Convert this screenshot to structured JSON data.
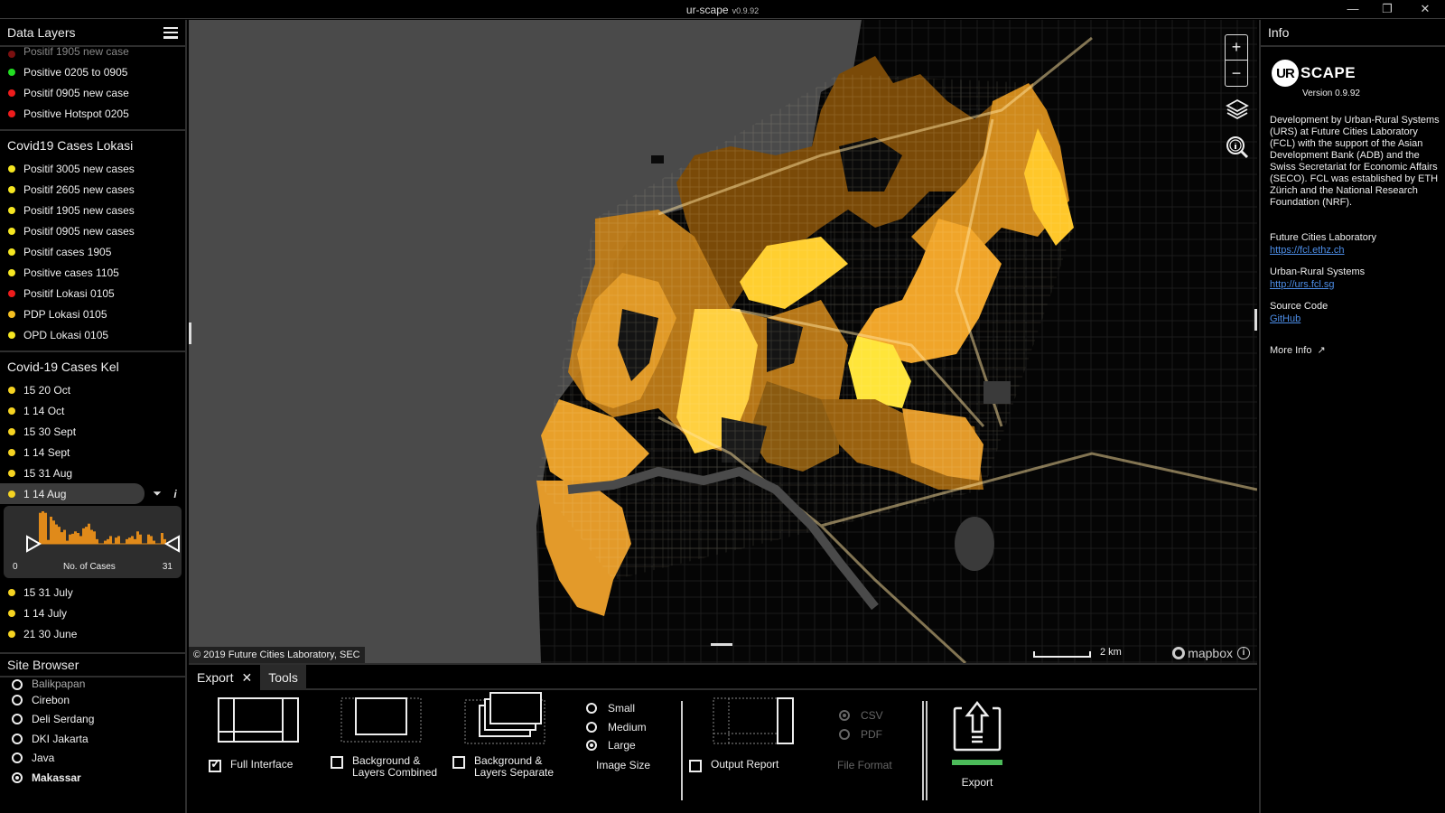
{
  "window": {
    "title": "ur-scape",
    "version": "v0.9.92",
    "controls": {
      "minimize": "—",
      "restore": "❐",
      "close": "✕"
    }
  },
  "data_layers": {
    "title": "Data Layers",
    "cut_item": "Positif 1905 new case",
    "top_items": [
      {
        "label": "Positive 0205 to 0905",
        "color": "#22dd22"
      },
      {
        "label": "Positif 0905 new case",
        "color": "#ee1c1c"
      },
      {
        "label": "Positive Hotspot 0205",
        "color": "#ee1c1c"
      }
    ],
    "groups": [
      {
        "title": "Covid19 Cases Lokasi",
        "items": [
          {
            "label": "Positif 3005 new cases",
            "color": "#f5e621"
          },
          {
            "label": "Positif 2605 new cases",
            "color": "#f5e621"
          },
          {
            "label": "Positif 1905 new cases",
            "color": "#f5e621"
          },
          {
            "label": "Positif 0905 new cases",
            "color": "#f5e621"
          },
          {
            "label": "Positif cases 1905",
            "color": "#f5e621"
          },
          {
            "label": "Positive cases 1105",
            "color": "#f5e621"
          },
          {
            "label": "Positif Lokasi 0105",
            "color": "#ee1c1c"
          },
          {
            "label": "PDP Lokasi 0105",
            "color": "#f5c021"
          },
          {
            "label": "OPD Lokasi 0105",
            "color": "#f5e621"
          }
        ]
      },
      {
        "title": "Covid-19 Cases Kel",
        "items_before": [
          {
            "label": "15 20 Oct",
            "color": "#f5d321"
          },
          {
            "label": "1 14 Oct",
            "color": "#f5d321"
          },
          {
            "label": "15 30 Sept",
            "color": "#f5d321"
          },
          {
            "label": "1 14 Sept",
            "color": "#f5d321"
          },
          {
            "label": "15 31 Aug",
            "color": "#f5d321"
          }
        ],
        "selected": {
          "label": "1 14 Aug",
          "color": "#f5d321",
          "filter_icon": "filter-icon",
          "info_icon": "info-icon"
        },
        "histogram": {
          "min_label": "0",
          "max_label": "31",
          "axis_label": "No. of Cases",
          "bar_color": "#e08a1a",
          "values": [
            2,
            40,
            42,
            40,
            5,
            35,
            30,
            25,
            22,
            15,
            18,
            4,
            12,
            13,
            16,
            14,
            10,
            20,
            22,
            26,
            18,
            16,
            6,
            0,
            0,
            4,
            6,
            10,
            0,
            8,
            10,
            0,
            0,
            6,
            8,
            10,
            6,
            16,
            12,
            0,
            0,
            12,
            10,
            4,
            0,
            0,
            14,
            6
          ]
        },
        "items_after": [
          {
            "label": "15 31 July",
            "color": "#f5d321"
          },
          {
            "label": "1 14 July",
            "color": "#f5d321"
          },
          {
            "label": "21 30 June",
            "color": "#f5d321"
          }
        ]
      }
    ]
  },
  "site_browser": {
    "title": "Site Browser",
    "cut_item": "Balikpapan",
    "sites": [
      {
        "label": "Cirebon",
        "selected": false
      },
      {
        "label": "Deli Serdang",
        "selected": false
      },
      {
        "label": "DKI Jakarta",
        "selected": false
      },
      {
        "label": "Java",
        "selected": false
      },
      {
        "label": "Makassar",
        "selected": true
      }
    ]
  },
  "map": {
    "attribution": "© 2019 Future Cities Laboratory, SEC",
    "scale_label": "2 km",
    "provider": "mapbox",
    "zoom_in": "+",
    "zoom_out": "−",
    "tools": [
      "layers-icon",
      "inspect-icon"
    ],
    "colors": {
      "sea": "#4a4a4a",
      "land": "#050505",
      "roads": "#5a5a5a",
      "light": "#ffd83a",
      "mid": "#e8a02a",
      "dark": "#7a4a08"
    }
  },
  "bottom_panel": {
    "tabs": [
      {
        "label": "Export",
        "active": true,
        "closable": true
      },
      {
        "label": "Tools",
        "active": false
      }
    ],
    "export_options": [
      {
        "label_line1": "Full Interface",
        "label_line2": "",
        "checked": true
      },
      {
        "label_line1": "Background &",
        "label_line2": "Layers Combined",
        "checked": false
      },
      {
        "label_line1": "Background &",
        "label_line2": "Layers Separate",
        "checked": false
      }
    ],
    "image_size": {
      "caption": "Image Size",
      "options": [
        {
          "label": "Small",
          "selected": false
        },
        {
          "label": "Medium",
          "selected": false
        },
        {
          "label": "Large",
          "selected": true
        }
      ]
    },
    "output_report": {
      "label": "Output Report",
      "checked": false
    },
    "file_format": {
      "caption": "File Format",
      "disabled": true,
      "options": [
        {
          "label": "CSV",
          "selected": true
        },
        {
          "label": "PDF",
          "selected": false
        }
      ]
    },
    "export_button": {
      "label": "Export",
      "accent": "#4cbb5a"
    }
  },
  "info_panel": {
    "title": "Info",
    "logo_ur": "UR",
    "logo_scape": "SCAPE",
    "version": "Version 0.9.92",
    "about": "Development by Urban-Rural Systems (URS) at Future Cities Laboratory (FCL) with the support of the Asian Development Bank (ADB) and the Swiss Secretariat for Economic Affairs (SECO). FCL was established by ETH Zürich and the National Research Foundation (NRF).",
    "links": [
      {
        "title": "Future Cities Laboratory",
        "link": "https://fcl.ethz.ch"
      },
      {
        "title": "Urban-Rural Systems",
        "link": "http://urs.fcl.sg"
      },
      {
        "title": "Source Code",
        "link": "GitHub"
      }
    ],
    "more_info": "More Info"
  }
}
